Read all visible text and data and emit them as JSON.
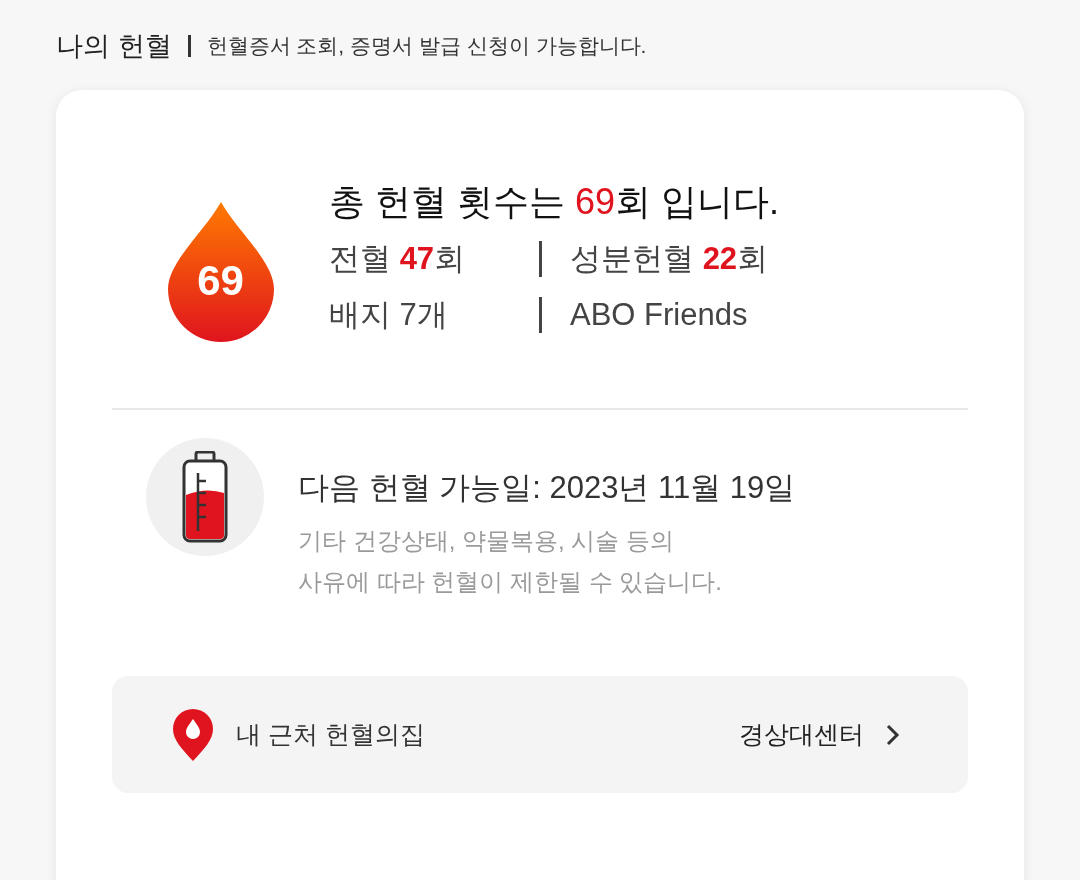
{
  "header": {
    "title": "나의 헌혈",
    "subtitle": "헌혈증서 조회, 증명서 발급 신청이 가능합니다."
  },
  "summary": {
    "badge": "69",
    "before": "총 헌혈 횟수는 ",
    "count": "69",
    "after": "회 입니다.",
    "stats": [
      {
        "kind": "count",
        "label": "전혈 ",
        "value": "47",
        "unit": "회"
      },
      {
        "kind": "count",
        "label": "성분헌혈 ",
        "value": "22",
        "unit": "회"
      },
      {
        "kind": "text",
        "text": "배지 7개"
      },
      {
        "kind": "text",
        "text": "ABO Friends"
      }
    ]
  },
  "next": {
    "label": "다음 헌혈 가능일: 2023년 11월 19일",
    "note_lines": [
      "기타 건강상태, 약물복용, 시술 등의",
      "사유에 따라 헌혈이 제한될 수 있습니다."
    ]
  },
  "nearby": {
    "label": "내 근처 헌혈의집",
    "center": "경상대센터"
  }
}
